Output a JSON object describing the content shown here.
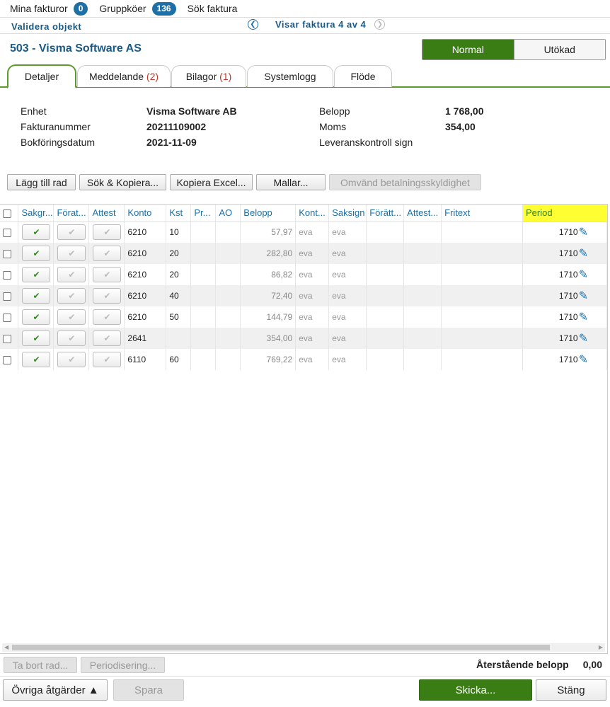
{
  "topnav": {
    "my_invoices": "Mina fakturor",
    "my_invoices_count": "0",
    "group_queues": "Gruppköer",
    "group_queues_count": "136",
    "search_invoice": "Sök faktura"
  },
  "validate_bar": {
    "title": "Validera objekt",
    "showing": "Visar faktura 4 av 4"
  },
  "header": {
    "vendor": "503 - Visma Software AS",
    "view_normal": "Normal",
    "view_extended": "Utökad"
  },
  "tabs": [
    {
      "label": "Detaljer",
      "count": ""
    },
    {
      "label": "Meddelande",
      "count": "2"
    },
    {
      "label": "Bilagor",
      "count": "1"
    },
    {
      "label": "Systemlogg",
      "count": ""
    },
    {
      "label": "Flöde",
      "count": ""
    }
  ],
  "details": {
    "unit_label": "Enhet",
    "unit_value": "Visma Software AB",
    "invoice_no_label": "Fakturanummer",
    "invoice_no_value": "20211109002",
    "posting_date_label": "Bokföringsdatum",
    "posting_date_value": "2021-11-09",
    "amount_label": "Belopp",
    "amount_value": "1 768,00",
    "vat_label": "Moms",
    "vat_value": "354,00",
    "delivery_check_label": "Leveranskontroll sign"
  },
  "toolbar": {
    "add_row": "Lägg till rad",
    "search_copy": "Sök & Kopiera...",
    "copy_excel": "Kopiera Excel...",
    "templates": "Mallar...",
    "reverse_charge": "Omvänd betalningsskyldighet"
  },
  "grid": {
    "columns": [
      "Sakgr...",
      "Förat...",
      "Attest",
      "Konto",
      "Kst",
      "Pr...",
      "AO",
      "Belopp",
      "Kont...",
      "Saksign",
      "Förätt...",
      "Attest...",
      "Fritext",
      "Period"
    ],
    "rows": [
      {
        "konto": "6210",
        "kst": "10",
        "belopp": "57,97",
        "kont": "eva",
        "saksign": "eva",
        "period": "1710"
      },
      {
        "konto": "6210",
        "kst": "20",
        "belopp": "282,80",
        "kont": "eva",
        "saksign": "eva",
        "period": "1710"
      },
      {
        "konto": "6210",
        "kst": "20",
        "belopp": "86,82",
        "kont": "eva",
        "saksign": "eva",
        "period": "1710"
      },
      {
        "konto": "6210",
        "kst": "40",
        "belopp": "72,40",
        "kont": "eva",
        "saksign": "eva",
        "period": "1710"
      },
      {
        "konto": "6210",
        "kst": "50",
        "belopp": "144,79",
        "kont": "eva",
        "saksign": "eva",
        "period": "1710"
      },
      {
        "konto": "2641",
        "kst": "",
        "belopp": "354,00",
        "kont": "eva",
        "saksign": "eva",
        "period": "1710"
      },
      {
        "konto": "6110",
        "kst": "60",
        "belopp": "769,22",
        "kont": "eva",
        "saksign": "eva",
        "period": "1710"
      }
    ]
  },
  "footer": {
    "delete_row": "Ta bort rad...",
    "accrual": "Periodisering...",
    "remaining_label": "Återstående belopp",
    "remaining_value": "0,00",
    "other_actions": "Övriga åtgärder ▲",
    "save": "Spara",
    "send": "Skicka...",
    "close": "Stäng"
  },
  "colors": {
    "accent_green": "#3a7d14",
    "link_blue": "#1d6fa5",
    "highlight_yellow": "#ffff33"
  }
}
